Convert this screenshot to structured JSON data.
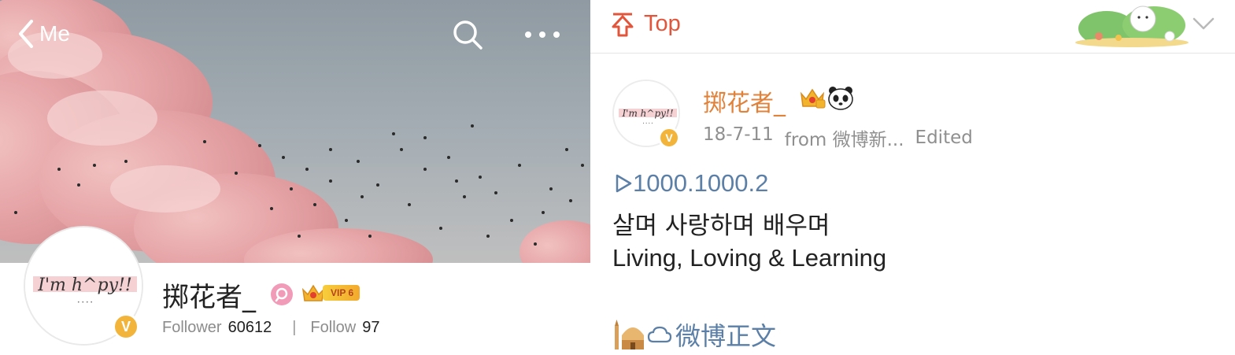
{
  "profile": {
    "back_label": "Me",
    "username": "掷花者_",
    "vip_label": "VIP 6",
    "verified_mark": "V",
    "avatar_text": "I'm h^py!!",
    "stats": {
      "follower_label": "Follower",
      "follower_count": "60612",
      "separator": "|",
      "follow_label": "Follow",
      "follow_count": "97"
    }
  },
  "post": {
    "header_label": "Top",
    "author": "掷花者_",
    "date": "18-7-11",
    "source": "from 微博新...",
    "edited": "Edited",
    "video_link": "1000.1000.2",
    "text_ko": "살며 사랑하며 배우며",
    "text_en": "Living, Loving & Learning",
    "weibo_link": "微博正文",
    "verified_mark": "V",
    "avatar_text": "I'm h^py!!"
  },
  "colors": {
    "accent_orange": "#e1823a",
    "top_red": "#e2553b",
    "link_blue": "#5b7fa6",
    "verified_yellow": "#f3b43c"
  },
  "icons": [
    "chevron-left-icon",
    "search-icon",
    "more-icon",
    "pin-top-icon",
    "chevron-down-icon",
    "crown-icon",
    "panda-icon",
    "play-icon",
    "mosque-icon",
    "link-icon"
  ]
}
